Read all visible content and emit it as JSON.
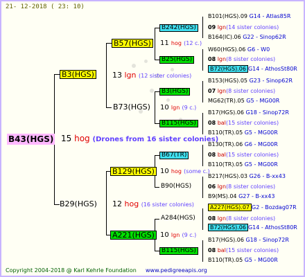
{
  "date": "21- 12-2018 ( 23: 10)",
  "footer": {
    "copyright": "Copyright 2004-2018 @ Karl Kehrle Foundation",
    "url": "www.pedigreeapis.org"
  },
  "root": {
    "name": "B43(HGS)",
    "generation": "15",
    "status": "hog",
    "note": "(Drones from 16 sister colonies)"
  },
  "gen1": [
    {
      "name": "B3(HGS)",
      "generation": "13",
      "status": "lgn",
      "note": "(12 sister colonies)"
    },
    {
      "name": "B29(HGS)",
      "generation": "12",
      "status": "hog",
      "note": "(16 sister colonies)"
    }
  ],
  "gen2": [
    {
      "name": "B57(HGS)",
      "generation": "11",
      "status": "hog",
      "note": "(12 c.)"
    },
    {
      "name": "B73(HGS)",
      "generation": "10",
      "status": "lgn",
      "note": "(9 c.)"
    },
    {
      "name": "B129(HGS)",
      "generation": "10",
      "status": "hog",
      "note": "(some c.)"
    },
    {
      "name": "A221(HGS)",
      "generation": "10",
      "status": "lgn",
      "note": "(9 c.)"
    }
  ],
  "gen3": [
    {
      "name": "B242(HGS)",
      "generation": "09",
      "status": "lgn",
      "note": "(14 sister colonies)"
    },
    {
      "name": "B25(HGS)",
      "generation": "08",
      "status": "lgn",
      "note": "(8 sister colonies)"
    },
    {
      "name": "B3(HGS)",
      "generation": "07",
      "status": "lgn",
      "note": "(8 sister colonies)"
    },
    {
      "name": "B115(HGS)",
      "generation": "08",
      "status": "bal",
      "note": "(15 sister colonies)"
    },
    {
      "name": "B67(TR)",
      "generation": "08",
      "status": "bal",
      "note": "(15 sister colonies)"
    },
    {
      "name": "B90(HGS)",
      "generation": "06",
      "status": "lgn",
      "note": "(8 sister colonies)"
    },
    {
      "name": "A284(HGS)",
      "generation": "08",
      "status": "lgn",
      "note": "(8 sister colonies)"
    },
    {
      "name": "B115(HGS)",
      "generation": "08",
      "status": "bal",
      "note": "(15 sister colonies)"
    }
  ],
  "leaves": [
    {
      "name": "B101(HGS).09",
      "code": "G14 - Atlas85R"
    },
    {
      "name": "B164(IC).06",
      "code": "G22 - Sinop62R"
    },
    {
      "name": "W60(HGS).06",
      "code": "G6 - W0"
    },
    {
      "name": "B72(HGS).06",
      "code": "G14 - AthosSt80R"
    },
    {
      "name": "B153(HGS).05",
      "code": "G23 - Sinop62R"
    },
    {
      "name": "MG62(TR).05",
      "code": "G5 - MG00R"
    },
    {
      "name": "B17(HGS).06",
      "code": "G18 - Sinop72R"
    },
    {
      "name": "B110(TR).05",
      "code": "G5 - MG00R"
    },
    {
      "name": "B130(TR).06",
      "code": "G6 - MG00R"
    },
    {
      "name": "B110(TR).05",
      "code": "G5 - MG00R"
    },
    {
      "name": "B217(HGS).03",
      "code": "G26 - B-xx43"
    },
    {
      "name": "B9(MS).04",
      "code": "G27 - B-xx43"
    },
    {
      "name": "A227(HGS).07",
      "code": "G2 - Bozdag07R"
    },
    {
      "name": "B72(HGS).06",
      "code": "G14 - AthosSt80R"
    },
    {
      "name": "B17(HGS).06",
      "code": "G18 - Sinop72R"
    },
    {
      "name": "B110(TR).05",
      "code": "G5 - MG00R"
    }
  ],
  "colors": {
    "border": "#c8b4ff",
    "background": "#fffff4",
    "yellow": "#ffff00",
    "green": "#00e000",
    "cyan": "#40e0f0",
    "pink": "#ffb8ff"
  }
}
